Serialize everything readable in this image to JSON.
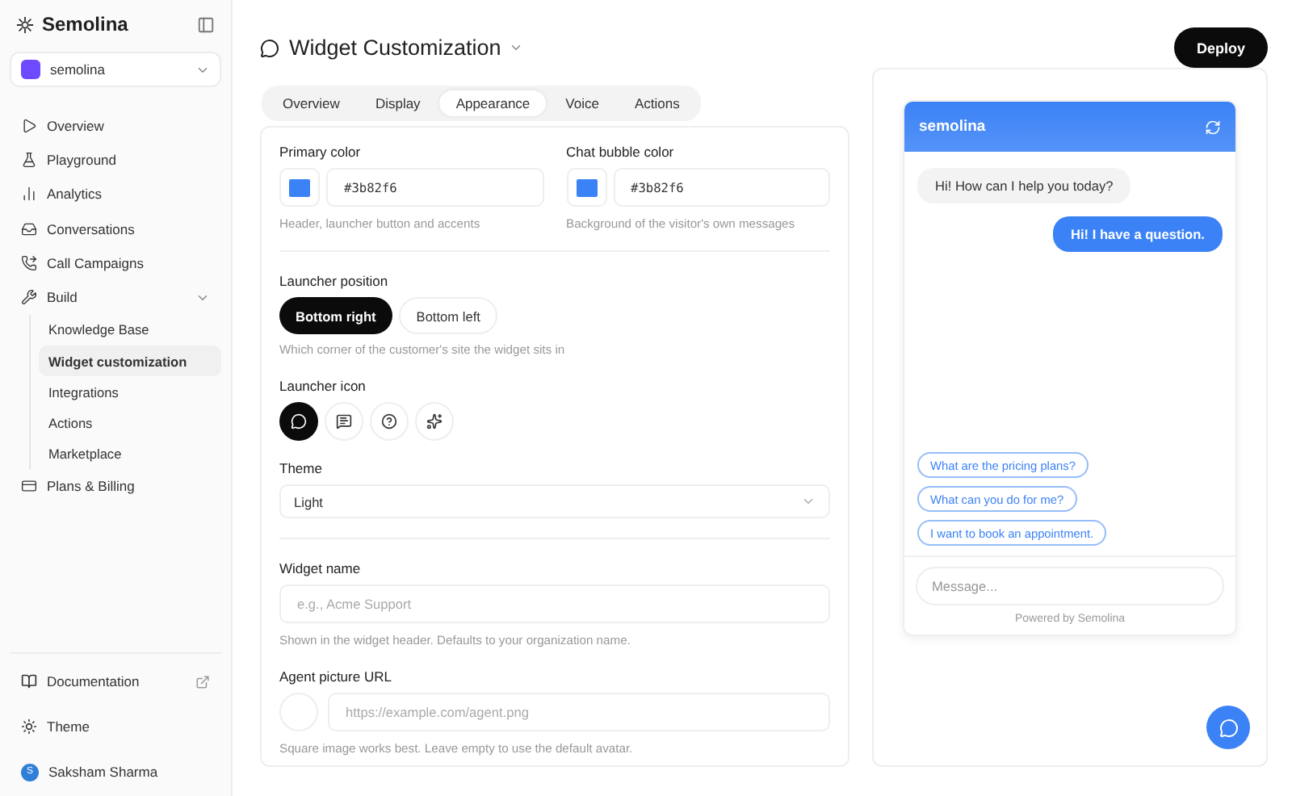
{
  "sidebar": {
    "brand": "Semolina",
    "workspace": {
      "name": "semolina"
    },
    "nav": [
      {
        "label": "Overview",
        "selected": false
      },
      {
        "label": "Playground",
        "selected": false
      },
      {
        "label": "Analytics",
        "selected": false
      },
      {
        "label": "Conversations",
        "selected": false
      },
      {
        "label": "Call Campaigns",
        "selected": false
      },
      {
        "label": "Build",
        "selected": false,
        "expanded": true,
        "children": [
          {
            "label": "Knowledge Base",
            "selected": false
          },
          {
            "label": "Widget customization",
            "selected": true
          },
          {
            "label": "Integrations",
            "selected": false
          },
          {
            "label": "Actions",
            "selected": false
          },
          {
            "label": "Marketplace",
            "selected": false
          }
        ]
      },
      {
        "label": "Plans & Billing",
        "selected": false
      }
    ],
    "documentation": "Documentation",
    "theme": "Theme",
    "user": {
      "initial": "S",
      "name": "Saksham Sharma"
    }
  },
  "header": {
    "title": "Widget Customization",
    "action": "Deploy"
  },
  "tabs": [
    {
      "label": "Overview",
      "selected": false
    },
    {
      "label": "Display",
      "selected": false
    },
    {
      "label": "Appearance",
      "selected": true
    },
    {
      "label": "Voice",
      "selected": false
    },
    {
      "label": "Actions",
      "selected": false
    }
  ],
  "form": {
    "colors": [
      {
        "label": "Primary color",
        "value": "#3b82f6",
        "hint": "Header, launcher button and accents"
      },
      {
        "label": "Chat bubble color",
        "value": "#3b82f6",
        "hint": "Background of the visitor's own messages"
      }
    ],
    "launcher_position": {
      "label": "Launcher position",
      "options": [
        {
          "label": "Bottom right",
          "selected": true
        },
        {
          "label": "Bottom left",
          "selected": false
        }
      ],
      "hint": "Which corner of the customer's site the widget sits in"
    },
    "launcher_icon": {
      "label": "Launcher icon",
      "options": [
        {
          "selected": true
        },
        {
          "selected": false
        },
        {
          "selected": false
        },
        {
          "selected": false
        }
      ]
    },
    "theme": {
      "label": "Theme",
      "value": "Light"
    },
    "widget_name": {
      "label": "Widget name",
      "placeholder": "e.g., Acme Support",
      "hint": "Shown in the widget header. Defaults to your organization name."
    },
    "agent_picture": {
      "label": "Agent picture URL",
      "placeholder": "https://example.com/agent.png",
      "hint": "Square image works best. Leave empty to use the default avatar."
    }
  },
  "preview": {
    "title": "semolina",
    "messages": [
      {
        "kind": "bot",
        "text": "Hi! How can I help you today?"
      },
      {
        "kind": "user",
        "text": "Hi! I have a question."
      }
    ],
    "suggestions": [
      "What are the pricing plans?",
      "What can you do for me?",
      "I want to book an appointment."
    ],
    "input_placeholder": "Message...",
    "footer": "Powered by Semolina"
  }
}
